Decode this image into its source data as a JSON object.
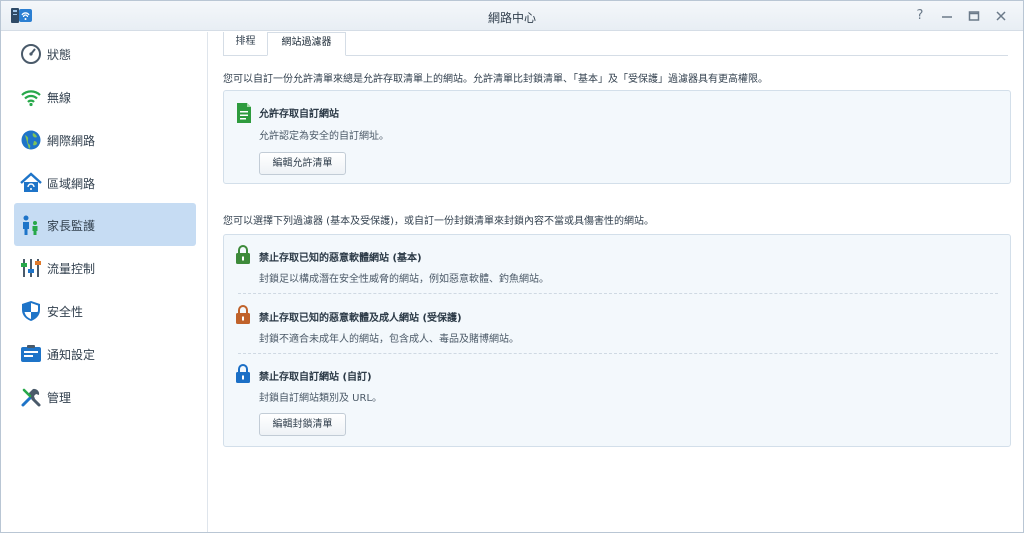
{
  "window": {
    "title": "網路中心"
  },
  "sidebar": {
    "items": [
      {
        "label": "狀態",
        "icon": "dashboard-icon"
      },
      {
        "label": "無線",
        "icon": "wifi-icon"
      },
      {
        "label": "網際網路",
        "icon": "globe-icon"
      },
      {
        "label": "區域網路",
        "icon": "home-network-icon"
      },
      {
        "label": "家長監護",
        "icon": "family-icon"
      },
      {
        "label": "流量控制",
        "icon": "sliders-icon"
      },
      {
        "label": "安全性",
        "icon": "shield-icon"
      },
      {
        "label": "通知設定",
        "icon": "notification-icon"
      },
      {
        "label": "管理",
        "icon": "tools-icon"
      }
    ],
    "active_index": 4
  },
  "tabs": [
    {
      "label": "排程"
    },
    {
      "label": "網站過濾器"
    }
  ],
  "active_tab_index": 1,
  "allow_section": {
    "intro": "您可以自訂一份允許清單來總是允許存取清單上的網站。允許清單比封鎖清單、「基本」及「受保護」過濾器具有更高權限。",
    "title": "允許存取自訂網站",
    "description": "允許認定為安全的自訂網址。",
    "button": "編輯允許清單"
  },
  "block_section": {
    "intro": "您可以選擇下列過濾器 (基本及受保護)，或自訂一份封鎖清單來封鎖內容不當或具傷害性的網站。",
    "items": [
      {
        "title": "禁止存取已知的惡意軟體網站 (基本)",
        "description": "封鎖足以構成潛在安全性威脅的網站，例如惡意軟體、釣魚網站。"
      },
      {
        "title": "禁止存取已知的惡意軟體及成人網站 (受保護)",
        "description": "封鎖不適合未成年人的網站，包含成人、毒品及賭博網站。"
      },
      {
        "title": "禁止存取自訂網站 (自訂)",
        "description": "封鎖自訂網站類別及 URL。"
      }
    ],
    "button": "編輯封鎖清單"
  },
  "colors": {
    "active_nav": "#c6dcf3",
    "lock_basic": "#3d8a3a",
    "lock_protected": "#c0622b",
    "lock_custom": "#1b6fc6",
    "doc_icon": "#2e9b3e"
  }
}
